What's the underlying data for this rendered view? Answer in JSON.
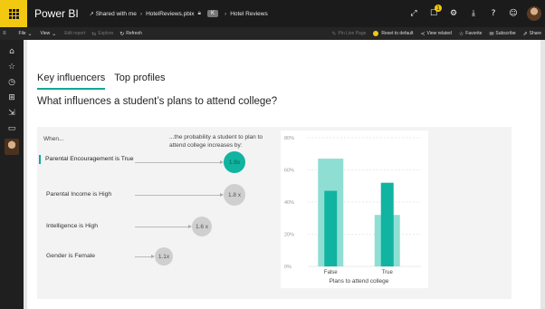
{
  "app": {
    "brand": "Power BI",
    "breadcrumb": {
      "shared": "Shared with me",
      "file": "HotelReviews.pbix",
      "pill": "K",
      "report": "Hotel Reviews"
    },
    "notification_count": "1"
  },
  "actionbar": {
    "file": "File",
    "view": "View",
    "edit_report": "Edit report",
    "explore": "Explore",
    "refresh": "Refresh",
    "pin_live_page": "Pin Live Page",
    "reset_to_default": "Reset to default",
    "view_related": "View related",
    "favorite": "Favorite",
    "subscribe": "Subscribe",
    "share": "Share"
  },
  "tabs": [
    {
      "label": "Key influencers",
      "active": true
    },
    {
      "label": "Top profiles",
      "active": false
    }
  ],
  "question": "What influences a student’s plans to attend college?",
  "influencers": {
    "when_label": "When...",
    "probability_label": "...the probability a student to plan to attend college increases by:",
    "factors": [
      {
        "label": "Parental Encouragement is True",
        "value": "1.8x",
        "multiplier": 1.8,
        "selected": true
      },
      {
        "label": "Parental Income is High",
        "value": "1.8 x",
        "multiplier": 1.8,
        "selected": false
      },
      {
        "label": "Intelligence is High",
        "value": "1.6 x",
        "multiplier": 1.6,
        "selected": false
      },
      {
        "label": "Gender is Female",
        "value": "1.1x",
        "multiplier": 1.1,
        "selected": false
      }
    ]
  },
  "chart_data": {
    "type": "bar",
    "categories": [
      "False",
      "True"
    ],
    "series": [
      {
        "values": [
          67,
          32
        ],
        "color": "#8fded4"
      },
      {
        "values": [
          47,
          52
        ],
        "color": "#10b4a0"
      }
    ],
    "xlabel": "Plans to attend college",
    "ylabel": "",
    "ylim": [
      0,
      80
    ],
    "yticks": [
      "0%",
      "20%",
      "40%",
      "60%",
      "80%"
    ],
    "grid": true
  },
  "colors": {
    "accent": "#10a897",
    "brand_yellow": "#f2c811"
  }
}
